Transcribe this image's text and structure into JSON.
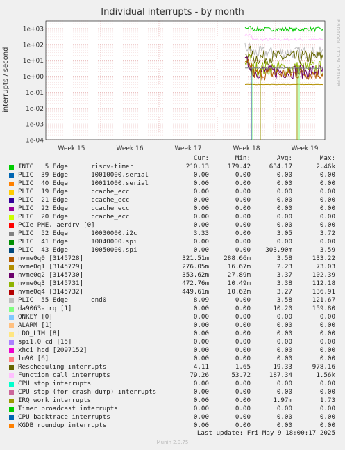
{
  "title": "Individual interrupts - by month",
  "side_label": "RRDTOOL / TOBI OETIKER",
  "footer": "Munin 2.0.75",
  "last_update": "Last update:  Fri May  9 18:00:17 2025",
  "columns": [
    "Cur:",
    "Min:",
    "Avg:",
    "Max:"
  ],
  "chart_data": {
    "type": "line",
    "ylabel": "interrupts / second",
    "yscale": "log",
    "ylim": [
      0.0001,
      3000
    ],
    "y_ticks": [
      "1e-04",
      "1e-03",
      "1e-02",
      "1e-01",
      "1e+00",
      "1e+01",
      "1e+02",
      "1e+03"
    ],
    "x_ticks": [
      "Week 15",
      "Week 16",
      "Week 17",
      "Week 18",
      "Week 19"
    ],
    "grid": true,
    "series": [
      {
        "name": "INTC   5 Edge      riscv-timer",
        "color": "#00cc00",
        "cur": "210.13",
        "min": "179.42",
        "avg": "634.17",
        "max": "2.46k"
      },
      {
        "name": "PLIC  39 Edge      10010000.serial",
        "color": "#0066b3",
        "cur": "0.00",
        "min": "0.00",
        "avg": "0.00",
        "max": "0.00"
      },
      {
        "name": "PLIC  40 Edge      10011000.serial",
        "color": "#ff8000",
        "cur": "0.00",
        "min": "0.00",
        "avg": "0.00",
        "max": "0.00"
      },
      {
        "name": "PLIC  19 Edge      ccache_ecc",
        "color": "#ffcc00",
        "cur": "0.00",
        "min": "0.00",
        "avg": "0.00",
        "max": "0.00"
      },
      {
        "name": "PLIC  21 Edge      ccache_ecc",
        "color": "#330099",
        "cur": "0.00",
        "min": "0.00",
        "avg": "0.00",
        "max": "0.00"
      },
      {
        "name": "PLIC  22 Edge      ccache_ecc",
        "color": "#990099",
        "cur": "0.00",
        "min": "0.00",
        "avg": "0.00",
        "max": "0.00"
      },
      {
        "name": "PLIC  20 Edge      ccache_ecc",
        "color": "#ccff00",
        "cur": "0.00",
        "min": "0.00",
        "avg": "0.00",
        "max": "0.00"
      },
      {
        "name": "PCIe PME, aerdrv [0]",
        "color": "#ff0000",
        "cur": "0.00",
        "min": "0.00",
        "avg": "0.00",
        "max": "0.00"
      },
      {
        "name": "PLIC  52 Edge      10030000.i2c",
        "color": "#808080",
        "cur": "3.33",
        "min": "0.00",
        "avg": "3.05",
        "max": "3.72"
      },
      {
        "name": "PLIC  41 Edge      10040000.spi",
        "color": "#008f00",
        "cur": "0.00",
        "min": "0.00",
        "avg": "0.00",
        "max": "0.00"
      },
      {
        "name": "PLIC  43 Edge      10050000.spi",
        "color": "#00487d",
        "cur": "0.00",
        "min": "0.00",
        "avg": "303.90m",
        "max": "3.59"
      },
      {
        "name": "nvme0q0 [3145728]",
        "color": "#b35a00",
        "cur": "321.51m",
        "min": "288.66m",
        "avg": "3.58",
        "max": "133.22"
      },
      {
        "name": "nvme0q1 [3145729]",
        "color": "#b38f00",
        "cur": "276.05m",
        "min": "16.67m",
        "avg": "2.23",
        "max": "73.03"
      },
      {
        "name": "nvme0q2 [3145730]",
        "color": "#6b006b",
        "cur": "353.62m",
        "min": "27.89m",
        "avg": "3.37",
        "max": "102.39"
      },
      {
        "name": "nvme0q3 [3145731]",
        "color": "#8fb300",
        "cur": "472.76m",
        "min": "10.49m",
        "avg": "3.38",
        "max": "112.18"
      },
      {
        "name": "nvme0q4 [3145732]",
        "color": "#b30000",
        "cur": "449.61m",
        "min": "10.62m",
        "avg": "3.27",
        "max": "136.91"
      },
      {
        "name": "PLIC  55 Edge      end0",
        "color": "#bebebe",
        "cur": "8.09",
        "min": "0.00",
        "avg": "3.58",
        "max": "121.67"
      },
      {
        "name": "da9063-irq [1]",
        "color": "#80ff80",
        "cur": "0.00",
        "min": "0.00",
        "avg": "10.20",
        "max": "159.80"
      },
      {
        "name": "ONKEY [0]",
        "color": "#80c9ff",
        "cur": "0.00",
        "min": "0.00",
        "avg": "0.00",
        "max": "0.00"
      },
      {
        "name": "ALARM [1]",
        "color": "#ffc080",
        "cur": "0.00",
        "min": "0.00",
        "avg": "0.00",
        "max": "0.00"
      },
      {
        "name": "LDO_LIM [8]",
        "color": "#ffe680",
        "cur": "0.00",
        "min": "0.00",
        "avg": "0.00",
        "max": "0.00"
      },
      {
        "name": "spi1.0 cd [15]",
        "color": "#aa80ff",
        "cur": "0.00",
        "min": "0.00",
        "avg": "0.00",
        "max": "0.00"
      },
      {
        "name": "xhci_hcd [2097152]",
        "color": "#ee00cc",
        "cur": "0.00",
        "min": "0.00",
        "avg": "0.00",
        "max": "0.00"
      },
      {
        "name": "lm90 [6]",
        "color": "#ff8080",
        "cur": "0.00",
        "min": "0.00",
        "avg": "0.00",
        "max": "0.00"
      },
      {
        "name": "Rescheduling interrupts",
        "color": "#666600",
        "cur": "4.11",
        "min": "1.65",
        "avg": "19.33",
        "max": "978.16"
      },
      {
        "name": "Function call interrupts",
        "color": "#ffbfff",
        "cur": "79.26",
        "min": "53.72",
        "avg": "187.34",
        "max": "1.56k"
      },
      {
        "name": "CPU stop interrupts",
        "color": "#00ffcc",
        "cur": "0.00",
        "min": "0.00",
        "avg": "0.00",
        "max": "0.00"
      },
      {
        "name": "CPU stop (for crash dump) interrupts",
        "color": "#cc6699",
        "cur": "0.00",
        "min": "0.00",
        "avg": "0.00",
        "max": "0.00"
      },
      {
        "name": "IRQ work interrupts",
        "color": "#999900",
        "cur": "0.00",
        "min": "0.00",
        "avg": "1.97m",
        "max": "1.73"
      },
      {
        "name": "Timer broadcast interrupts",
        "color": "#00cc00",
        "cur": "0.00",
        "min": "0.00",
        "avg": "0.00",
        "max": "0.00"
      },
      {
        "name": "CPU backtrace interrupts",
        "color": "#0066b3",
        "cur": "0.00",
        "min": "0.00",
        "avg": "0.00",
        "max": "0.00"
      },
      {
        "name": "KGDB roundup interrupts",
        "color": "#ff8000",
        "cur": "0.00",
        "min": "0.00",
        "avg": "0.00",
        "max": "0.00"
      }
    ]
  }
}
